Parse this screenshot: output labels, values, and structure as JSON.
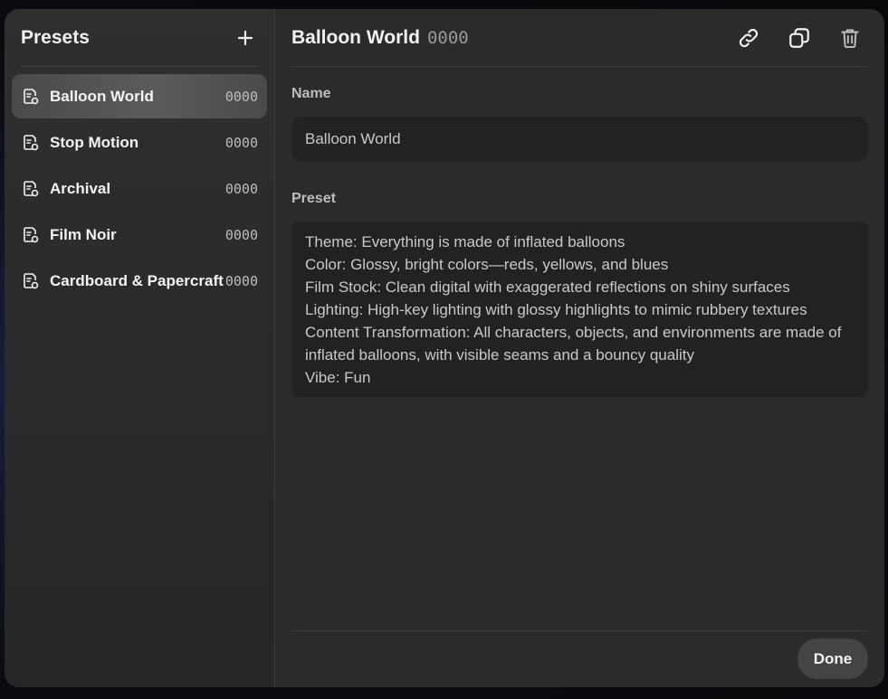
{
  "sidebar": {
    "title": "Presets",
    "items": [
      {
        "label": "Balloon World",
        "id": "0000",
        "active": true
      },
      {
        "label": "Stop Motion",
        "id": "0000",
        "active": false
      },
      {
        "label": "Archival",
        "id": "0000",
        "active": false
      },
      {
        "label": "Film Noir",
        "id": "0000",
        "active": false
      },
      {
        "label": "Cardboard & Papercraft",
        "id": "0000",
        "active": false
      }
    ]
  },
  "main": {
    "title": "Balloon World",
    "title_id": "0000",
    "name_label": "Name",
    "name_value": "Balloon World",
    "preset_label": "Preset",
    "preset_text": "Theme: Everything is made of inflated balloons\nColor: Glossy, bright colors—reds, yellows, and blues\nFilm Stock: Clean digital with exaggerated reflections on shiny surfaces\nLighting: High-key lighting with glossy highlights to mimic rubbery textures\nContent Transformation: All characters, objects, and environments are made of\ninflated balloons, with visible seams and a bouncy quality\nVibe: Fun",
    "done_label": "Done"
  },
  "icons": {
    "add": "plus-icon",
    "link": "link-icon",
    "duplicate": "copy-icon",
    "delete": "trash-icon",
    "preset": "document-preset-icon"
  },
  "colors": {
    "modal_bg": "#2b2b2b",
    "active_item": "#555555",
    "input_bg": "#222222",
    "button_bg": "#444444"
  }
}
